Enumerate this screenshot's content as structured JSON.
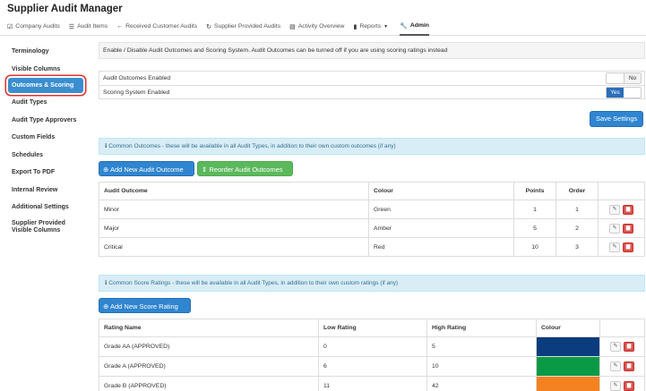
{
  "app": {
    "title": "Supplier Audit Manager"
  },
  "nav": {
    "items": [
      {
        "label": "Company Audits",
        "icon": "check-square-icon"
      },
      {
        "label": "Audit Items",
        "icon": "list-icon"
      },
      {
        "label": "Received Customer Audits",
        "icon": "arrow-left-icon"
      },
      {
        "label": "Supplier Provided Audits",
        "icon": "refresh-icon"
      },
      {
        "label": "Activity Overview",
        "icon": "list-alt-icon"
      },
      {
        "label": "Reports",
        "icon": "file-icon"
      },
      {
        "label": "Admin",
        "icon": "wrench-icon",
        "active": true
      }
    ]
  },
  "sidebar": {
    "items": [
      {
        "label": "Terminology"
      },
      {
        "label": "Visible Columns"
      },
      {
        "label": "Outcomes & Scoring",
        "active": true
      },
      {
        "label": "Audit Types"
      },
      {
        "label": "Audit Type Approvers"
      },
      {
        "label": "Custom Fields"
      },
      {
        "label": "Schedules"
      },
      {
        "label": "Export To PDF"
      },
      {
        "label": "Internal Review"
      },
      {
        "label": "Additional Settings"
      },
      {
        "label": "Supplier Provided",
        "label2": "Visible Columns"
      }
    ]
  },
  "description": "Enable / Disable Audit Outcomes and Scoring System. Audit Outcomes can be turned off if you are using scoring ratings instead",
  "settings": {
    "outcomes_label": "Audit Outcomes Enabled",
    "outcomes_toggle": "No",
    "scoring_label": "Scoring System Enabled",
    "scoring_toggle": "Yes",
    "save_label": "Save Settings"
  },
  "outcomes": {
    "info": "Common Outcomes - these will be available in all Audit Types, in addition to their own custom outcomes (if any)",
    "add_label": "Add New Audit Outcome",
    "reorder_label": "Reorder Audit Outcomes",
    "headers": {
      "outcome": "Audit Outcome",
      "colour": "Colour",
      "points": "Points",
      "order": "Order"
    },
    "rows": [
      {
        "outcome": "Minor",
        "colour": "Green",
        "points": "1",
        "order": "1"
      },
      {
        "outcome": "Major",
        "colour": "Amber",
        "points": "5",
        "order": "2"
      },
      {
        "outcome": "Critical",
        "colour": "Red",
        "points": "10",
        "order": "3"
      }
    ]
  },
  "scores": {
    "info": "Common Score Ratings - these will be available in all Audit Types, in addition to their own custom ratings (if any)",
    "add_label": "Add New Score Rating",
    "headers": {
      "name": "Rating Name",
      "low": "Low Rating",
      "high": "High Rating",
      "colour": "Colour"
    },
    "rows": [
      {
        "name": "Grade AA (APPROVED)",
        "low": "0",
        "high": "5",
        "swatch": "#0b3c7d"
      },
      {
        "name": "Grade A (APPROVED)",
        "low": "6",
        "high": "10",
        "swatch": "#0a9a45"
      },
      {
        "name": "Grade B (APPROVED)",
        "low": "11",
        "high": "42",
        "swatch": "#f58220"
      }
    ]
  }
}
